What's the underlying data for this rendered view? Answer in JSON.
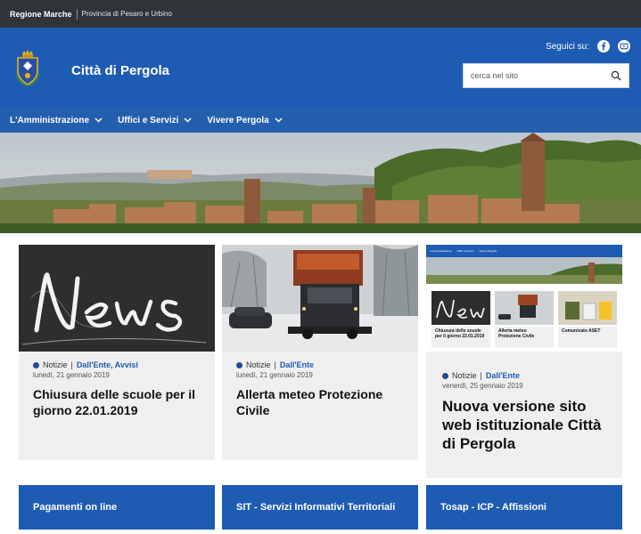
{
  "topbar": {
    "region": "Regione Marche",
    "province": "Provincia di Pesaro e Urbino"
  },
  "header": {
    "title": "Città di Pergola",
    "social_label": "Seguici su:",
    "social_icons": [
      "facebook-icon",
      "youtube-icon"
    ],
    "search_placeholder": "cerca nel sito"
  },
  "nav": {
    "items": [
      {
        "label": "L'Amministrazione"
      },
      {
        "label": "Uffici e Servizi"
      },
      {
        "label": "Vivere Pergola"
      }
    ]
  },
  "news": [
    {
      "category": "Notizie",
      "links": "Dall'Ente, Avvisi",
      "date": "lunedì, 21 gennaio 2019",
      "title": "Chiusura delle scuole per il giorno 22.01.2019"
    },
    {
      "category": "Notizie",
      "links": "Dall'Ente",
      "date": "lunedì, 21 gennaio 2019",
      "title": "Allerta meteo Protezione Civile"
    },
    {
      "category": "Notizie",
      "links": "Dall'Ente",
      "date": "venerdì, 25 gennaio 2019",
      "title": "Nuova versione sito web istituzionale Città di Pergola",
      "thumb": {
        "nav": [
          "L'Amministrazione",
          "Uffici e Servizi",
          "Vivere Pergola"
        ],
        "cards": [
          {
            "title": "Chiusura delle scuole per il giorno 22.01.2019"
          },
          {
            "title": "Allerta meteo Protezione Civile"
          },
          {
            "title": "Comunicato ASET"
          }
        ]
      }
    }
  ],
  "tiles": [
    {
      "label": "Pagamenti on line"
    },
    {
      "label": "SIT - Servizi Informativi Territoriali"
    },
    {
      "label": "Tosap - ICP - Affissioni"
    }
  ],
  "colors": {
    "primary": "#1e5cb3",
    "topbar": "#2f3437",
    "card_bg": "#efefef"
  }
}
